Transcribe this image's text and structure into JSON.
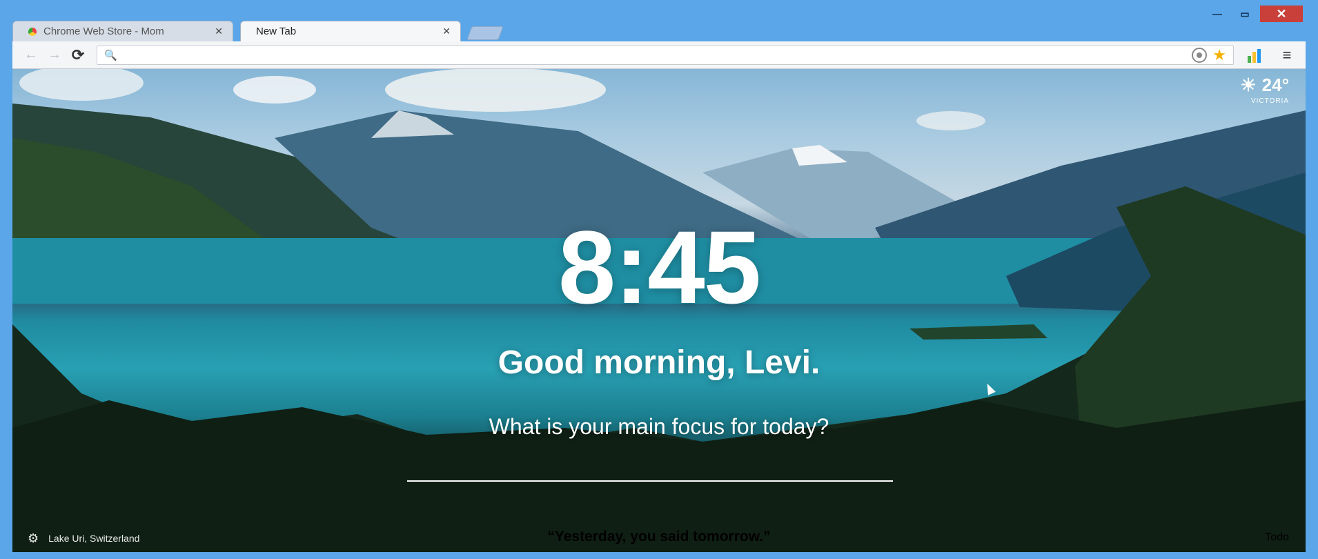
{
  "window": {
    "controls": {
      "minimize": "—",
      "maximize": "▭",
      "close": "✕"
    }
  },
  "tabs": [
    {
      "title": "Chrome Web Store - Mom",
      "close": "✕",
      "active": false
    },
    {
      "title": "New Tab",
      "close": "✕",
      "active": true
    }
  ],
  "toolbar": {
    "back": "←",
    "forward": "→",
    "reload": "⟳",
    "search_icon": "🔍",
    "address_value": "",
    "star": "★",
    "menu": "≡"
  },
  "weather": {
    "temperature": "24°",
    "location": "VICTORIA",
    "icon": "sun-icon"
  },
  "main": {
    "time": "8:45",
    "greeting": "Good morning, Levi.",
    "focus_question": "What is your main focus for today?",
    "focus_value": ""
  },
  "footer": {
    "photo_location": "Lake Uri, Switzerland",
    "quote": "“Yesterday, you said tomorrow.”",
    "todo": "Todo"
  }
}
